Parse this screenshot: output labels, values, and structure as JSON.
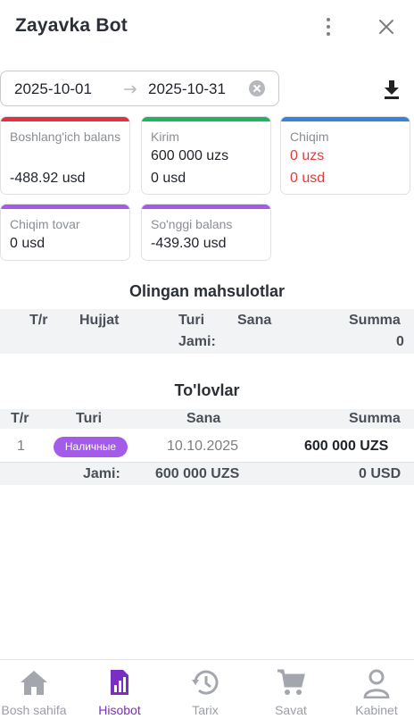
{
  "header": {
    "title": "Zayavka Bot",
    "menu_icon": "kebab-menu-icon",
    "close_icon": "close-icon"
  },
  "filter": {
    "date_start": "2025-10-01",
    "date_end": "2025-10-31",
    "arrow_icon": "arrow-right-icon",
    "clear_icon": "clear-circle-icon",
    "download_icon": "download-icon"
  },
  "cards": [
    {
      "label": "Boshlang'ich balans",
      "value1": "-488.92 usd",
      "value2": "",
      "color": "#e0323f"
    },
    {
      "label": "Kirim",
      "value1": "600 000 uzs",
      "value2": "0 usd",
      "color": "#22b35e"
    },
    {
      "label": "Chiqim",
      "value1": "0 uzs",
      "value2": "0 usd",
      "color": "#3b82d6"
    },
    {
      "label": "Chiqim tovar",
      "value1": "0 usd",
      "value2": "",
      "color": "#a55bea"
    },
    {
      "label": "So'nggi balans",
      "value1": "-439.30 usd",
      "value2": "",
      "color": "#a55bea"
    }
  ],
  "products": {
    "title": "Olingan mahsulotlar",
    "columns": [
      "T/r",
      "Hujjat",
      "Turi",
      "Sana",
      "Summa"
    ],
    "total_label": "Jami:",
    "total_value": "0"
  },
  "payments": {
    "title": "To'lovlar",
    "columns": [
      "T/r",
      "Turi",
      "Sana",
      "Summa"
    ],
    "rows": [
      {
        "index": "1",
        "type": "Наличные",
        "date": "10.10.2025",
        "amount": "600 000 UZS"
      }
    ],
    "total_label": "Jami:",
    "total_uzs": "600 000 UZS",
    "total_usd": "0 USD"
  },
  "nav": [
    {
      "label": "Bosh sahifa",
      "icon": "home-icon",
      "active": false
    },
    {
      "label": "Hisobot",
      "icon": "report-icon",
      "active": true
    },
    {
      "label": "Tarix",
      "icon": "history-icon",
      "active": false
    },
    {
      "label": "Savat",
      "icon": "cart-icon",
      "active": false
    },
    {
      "label": "Kabinet",
      "icon": "user-icon",
      "active": false
    }
  ],
  "colors": {
    "accent": "#7a2fc4",
    "badge": "#a55bea",
    "negative": "#e03c3c"
  }
}
